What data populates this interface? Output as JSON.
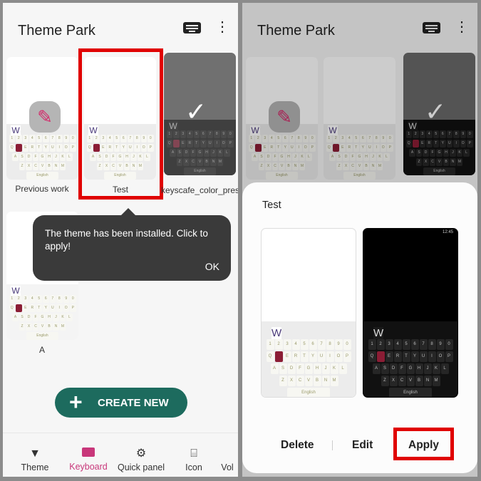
{
  "app": {
    "title": "Theme Park"
  },
  "keyboard": {
    "rows": [
      "1234567890",
      "QWERTYUIOP",
      "ASDFGHJKL",
      "ZXCVBNM"
    ],
    "popup_key": "W",
    "space_label": "English"
  },
  "themes": [
    {
      "name": "Previous work",
      "state": "edit"
    },
    {
      "name": "Test",
      "state": "highlighted"
    },
    {
      "name": "keyscafe_color_preset",
      "state": "applied"
    },
    {
      "name": "A",
      "state": "normal"
    }
  ],
  "tooltip": {
    "text": "The theme has been installed. Click to apply!",
    "ok": "OK"
  },
  "create_button": {
    "label": "CREATE NEW"
  },
  "nav": [
    {
      "label": "Theme",
      "icon": "brush-icon"
    },
    {
      "label": "Keyboard",
      "icon": "keyboard-icon",
      "active": true
    },
    {
      "label": "Quick panel",
      "icon": "gear-icon"
    },
    {
      "label": "Icon",
      "icon": "gift-icon"
    },
    {
      "label": "Vol",
      "icon": ""
    }
  ],
  "sheet": {
    "title": "Test",
    "delete": "Delete",
    "edit": "Edit",
    "apply": "Apply",
    "preview_time": "12:45"
  },
  "colors": {
    "accent": "#c8377a",
    "create": "#1d6b5e",
    "highlight": "#e00000"
  }
}
